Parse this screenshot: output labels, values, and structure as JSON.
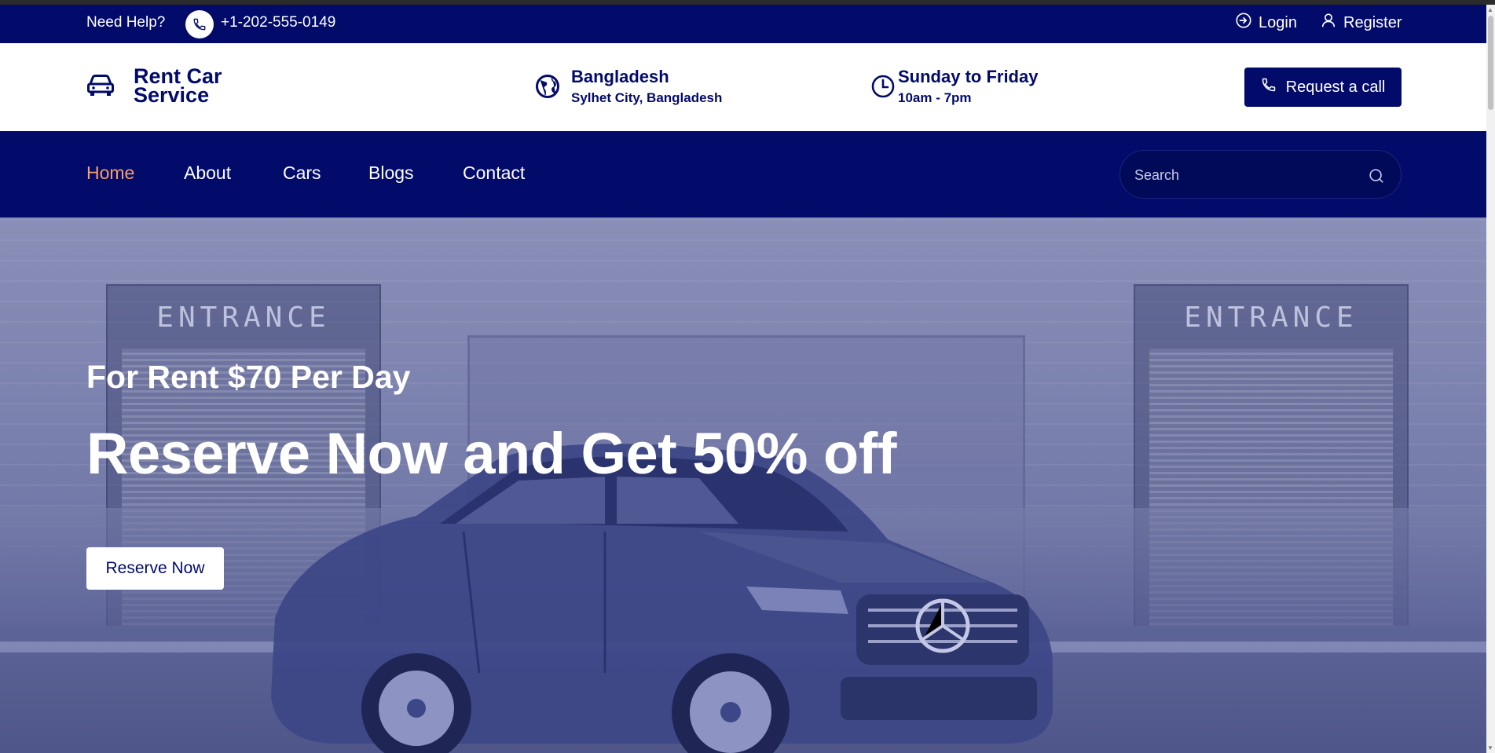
{
  "topbar": {
    "help_label": "Need Help?",
    "phone": "+1-202-555-0149",
    "login_label": "Login",
    "register_label": "Register"
  },
  "header": {
    "brand_line1": "Rent Car",
    "brand_line2": "Service",
    "location_title": "Bangladesh",
    "location_sub": "Sylhet City, Bangladesh",
    "hours_title": "Sunday to Friday",
    "hours_sub": "10am - 7pm",
    "call_button_label": "Request a call"
  },
  "nav": {
    "items": [
      {
        "label": "Home",
        "active": true
      },
      {
        "label": "About",
        "active": false
      },
      {
        "label": "Cars",
        "active": false
      },
      {
        "label": "Blogs",
        "active": false
      },
      {
        "label": "Contact",
        "active": false
      }
    ],
    "search_placeholder": "Search"
  },
  "hero": {
    "entrance_label_left": "ENTRANCE",
    "entrance_label_right": "ENTRANCE",
    "subtitle": "For Rent $70 Per Day",
    "title": "Reserve Now and Get 50% off",
    "button_label": "Reserve Now"
  },
  "colors": {
    "primary": "#020b6a",
    "active_nav": "#f4a06b",
    "hero_tint": "#6a72a3"
  },
  "icons": {
    "phone": "phone-icon",
    "login": "login-icon",
    "register": "user-icon",
    "brand": "car-icon",
    "location": "globe-icon",
    "hours": "clock-icon",
    "call": "phone-icon",
    "search": "search-icon"
  }
}
